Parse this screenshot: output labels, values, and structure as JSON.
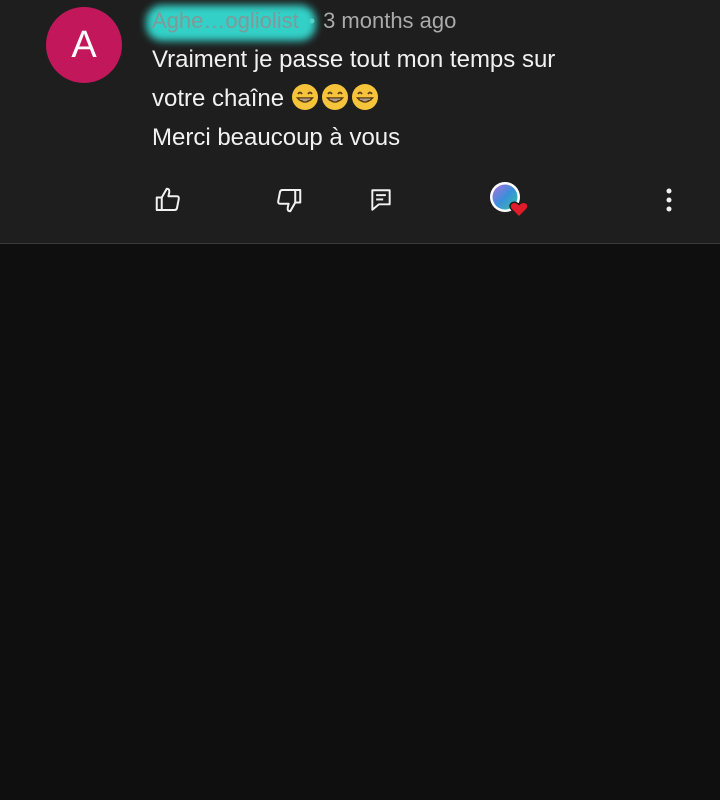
{
  "comment": {
    "avatar_letter": "A",
    "author": "Aghe…ogliolist",
    "separator": "•",
    "time": "3 months ago",
    "text_line1": "Vraiment je passe tout mon temps sur",
    "text_line2": "votre chaîne",
    "text_line3": "Merci beaucoup à vous",
    "emoji_count": 3
  },
  "actions": {
    "like_icon": "thumbs-up-icon",
    "dislike_icon": "thumbs-down-icon",
    "reply_icon": "comment-reply-icon",
    "creator_heart_icon": "creator-heart-icon",
    "more_icon": "more-vertical-icon"
  },
  "colors": {
    "background": "#0f0f0f",
    "card": "#1e1e1e",
    "avatar": "#c2185b",
    "heart": "#e21b2b"
  }
}
